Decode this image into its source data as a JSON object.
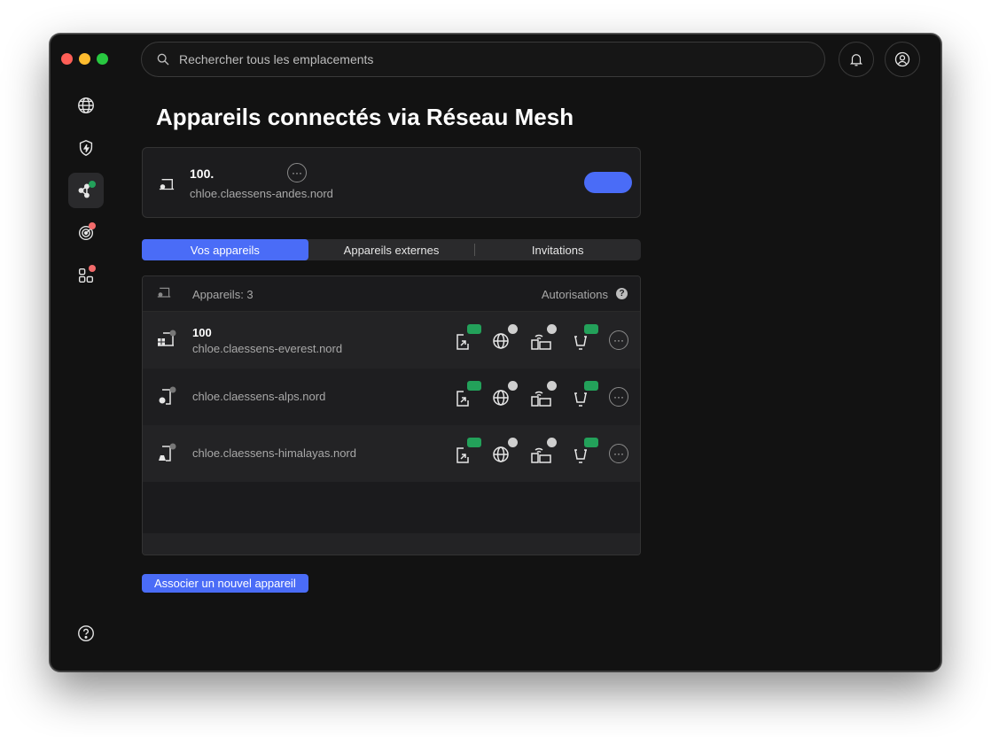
{
  "search": {
    "placeholder": "Rechercher tous les emplacements"
  },
  "page": {
    "title": "Appareils connectés via Réseau Mesh"
  },
  "this_device": {
    "ip": "100.",
    "hostname": "chloe.claessens-andes.nord"
  },
  "tabs": [
    {
      "label": "Vos appareils",
      "active": true
    },
    {
      "label": "Appareils externes",
      "active": false
    },
    {
      "label": "Invitations",
      "active": false
    }
  ],
  "device_list": {
    "count_label": "Appareils: 3",
    "permissions_label": "Autorisations",
    "help_glyph": "?",
    "rows": [
      {
        "ip": "100",
        "hostname": "chloe.claessens-everest.nord",
        "os_icon": "windows-icon"
      },
      {
        "ip": "",
        "hostname": "chloe.claessens-alps.nord",
        "os_icon": "apple-icon"
      },
      {
        "ip": "",
        "hostname": "chloe.claessens-himalayas.nord",
        "os_icon": "linux-icon"
      }
    ],
    "more_glyph": "···"
  },
  "actions": {
    "associate_label": "Associer un nouvel appareil"
  },
  "colors": {
    "accent": "#4a6cf7",
    "status_online": "#23a15a",
    "status_alert": "#f26b6b",
    "background": "#121212"
  }
}
